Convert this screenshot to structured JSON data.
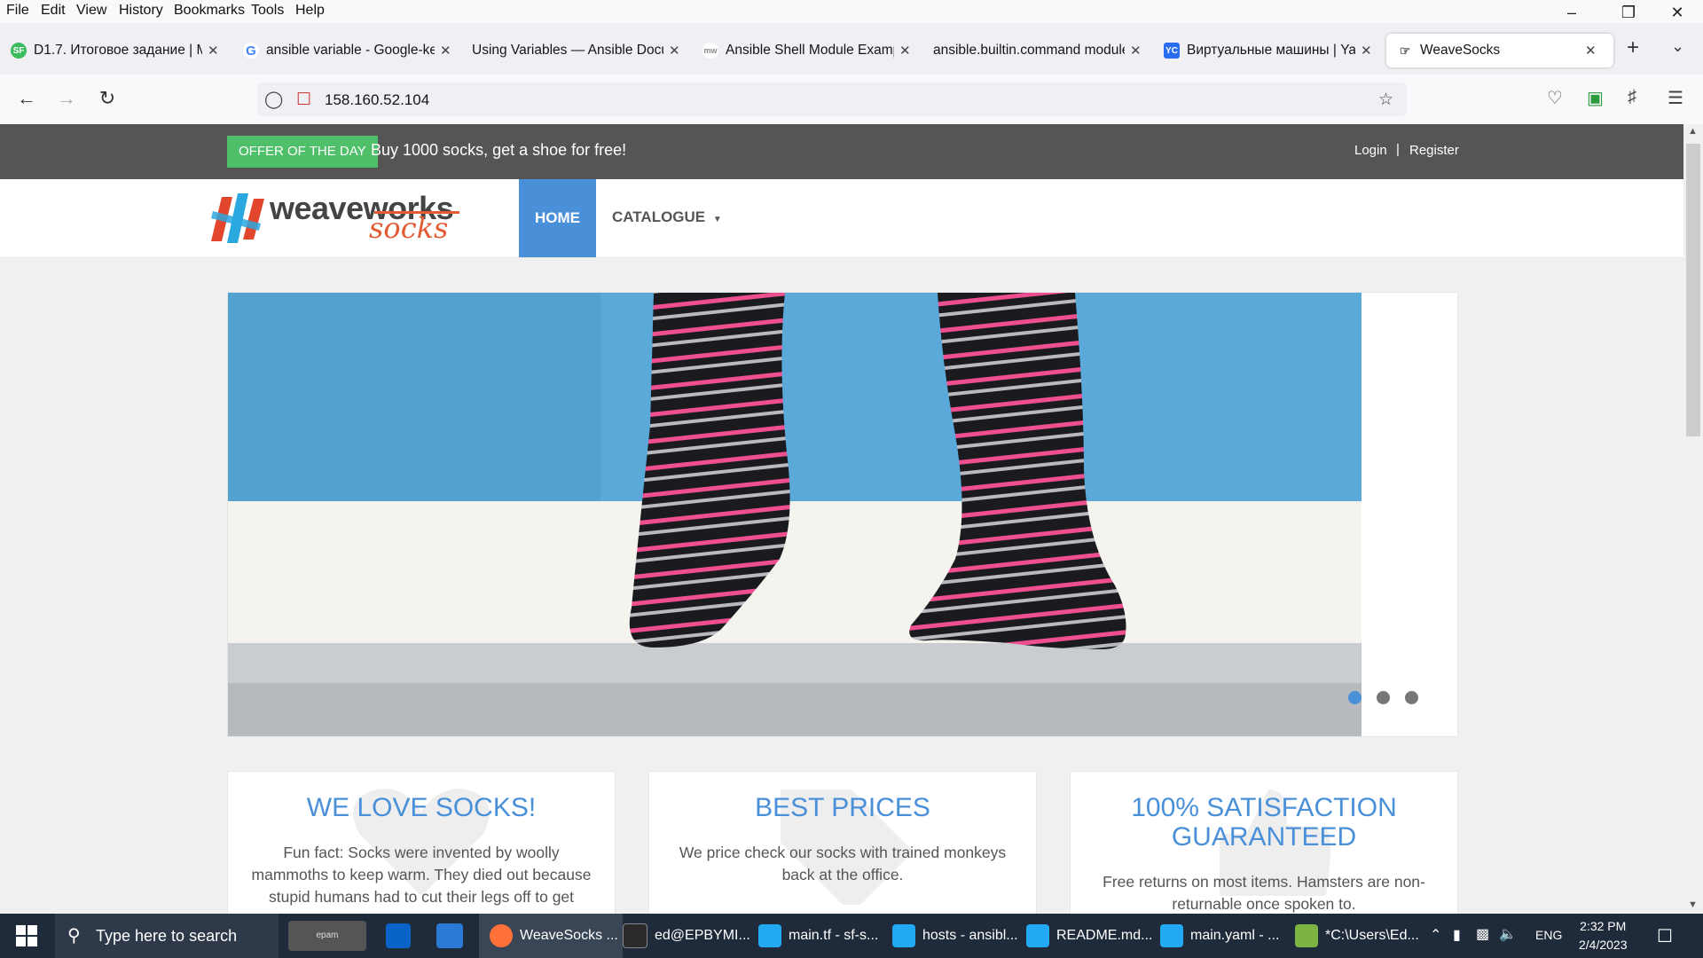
{
  "menu": [
    "File",
    "Edit",
    "View",
    "History",
    "Bookmarks",
    "Tools",
    "Help"
  ],
  "tabs": [
    {
      "title": "D1.7. Итоговое задание | M",
      "favicon": "skillfactory-icon",
      "color": "#3dbb5f",
      "glyph": "SF"
    },
    {
      "title": "ansible variable - Google-ke",
      "favicon": "google-icon",
      "color": "#ffffff",
      "glyph": "G"
    },
    {
      "title": "Using Variables — Ansible Docu",
      "favicon": "",
      "color": "",
      "glyph": ""
    },
    {
      "title": "Ansible Shell Module Examp",
      "favicon": "mw-icon",
      "color": "#ffffff",
      "glyph": "mw"
    },
    {
      "title": "ansible.builtin.command module",
      "favicon": "",
      "color": "",
      "glyph": ""
    },
    {
      "title": "Виртуальные машины | Yar",
      "favicon": "yandex-cloud-icon",
      "color": "#2a6cf0",
      "glyph": "YC"
    }
  ],
  "active_tab": {
    "title": "WeaveSocks"
  },
  "url": "158.160.52.104",
  "site": {
    "offer_badge": "OFFER OF THE DAY",
    "offer_text": "Buy 1000 socks, get a shoe for free!",
    "login": "Login",
    "separator": "|",
    "register": "Register",
    "logo_main": "weaveworks",
    "logo_sub": "socks",
    "nav_home": "HOME",
    "nav_catalogue": "CATALOGUE",
    "carousel_slides": 3,
    "carousel_active": 1,
    "boxes": [
      {
        "title": "WE LOVE SOCKS!",
        "text": "Fun fact: Socks were invented by woolly mammoths to keep warm. They died out because stupid humans had to cut their legs off to get"
      },
      {
        "title": "BEST PRICES",
        "text": "We price check our socks with trained monkeys back at the office."
      },
      {
        "title": "100% SATISFACTION GUARANTEED",
        "text": "Free returns on most items. Hamsters are non-returnable once spoken to."
      }
    ]
  },
  "taskbar": {
    "search_placeholder": "Type here to search",
    "epam": "epam",
    "apps": [
      {
        "label": "WeaveSocks ...",
        "color": "#ff7139"
      },
      {
        "label": "ed@EPBYMI...",
        "color": "#2b2b2b"
      },
      {
        "label": "main.tf - sf-s...",
        "color": "#23a9f2"
      },
      {
        "label": "hosts - ansibl...",
        "color": "#23a9f2"
      },
      {
        "label": "README.md...",
        "color": "#23a9f2"
      },
      {
        "label": "main.yaml - ...",
        "color": "#23a9f2"
      },
      {
        "label": "*C:\\Users\\Ed...",
        "color": "#7cb342"
      }
    ],
    "lang": "ENG",
    "time": "2:32 PM",
    "date": "2/4/2023"
  }
}
